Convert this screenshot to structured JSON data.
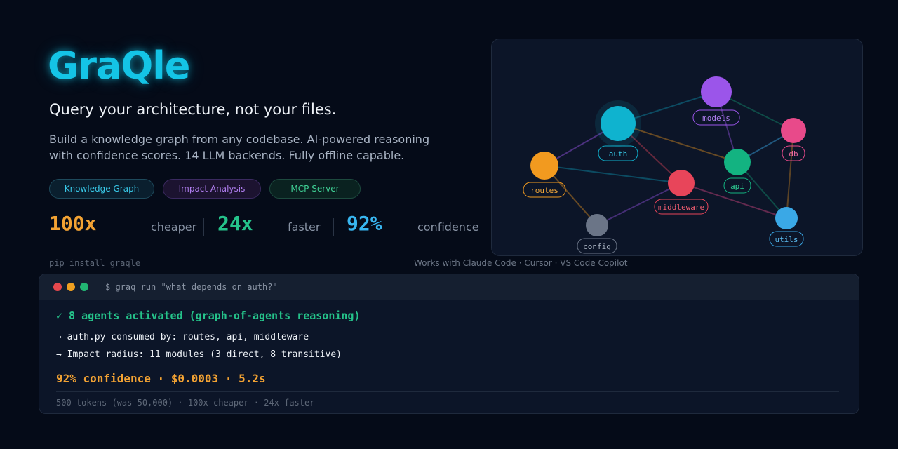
{
  "brand": {
    "name": "GraQle",
    "accent": "#14c4e6"
  },
  "hero": {
    "tagline": "Query your architecture, not your files.",
    "description": "Build a knowledge graph from any codebase. AI-powered reasoning with confidence scores. 14 LLM backends. Fully offline capable."
  },
  "pills": [
    {
      "label": "Knowledge Graph",
      "color": "#38c7e6"
    },
    {
      "label": "Impact Analysis",
      "color": "#b07ef0"
    },
    {
      "label": "MCP Server",
      "color": "#3fcf94"
    }
  ],
  "stats": [
    {
      "value": "100x",
      "label": "cheaper",
      "color": "#f2a233"
    },
    {
      "value": "24x",
      "label": "faster",
      "color": "#25c28a"
    },
    {
      "value": "92%",
      "label": "confidence",
      "color": "#38b6f0"
    }
  ],
  "install": "pip install graqle",
  "works_with": "Works with Claude Code · Cursor · VS Code Copilot",
  "graph": {
    "nodes": [
      {
        "id": "auth",
        "label": "auth",
        "color": "#0fb3cf"
      },
      {
        "id": "models",
        "label": "models",
        "color": "#9b55ea"
      },
      {
        "id": "db",
        "label": "db",
        "color": "#e84a8a"
      },
      {
        "id": "api",
        "label": "api",
        "color": "#13b381"
      },
      {
        "id": "routes",
        "label": "routes",
        "color": "#f29a1f"
      },
      {
        "id": "middleware",
        "label": "middleware",
        "color": "#e8455a"
      },
      {
        "id": "utils",
        "label": "utils",
        "color": "#3aa8e6"
      },
      {
        "id": "config",
        "label": "config",
        "color": "#6b7587"
      }
    ]
  },
  "terminal": {
    "dot_colors": [
      "#e5484d",
      "#f0a020",
      "#22b573"
    ],
    "command": "$ graq run \"what depends on auth?\"",
    "status": "✓ 8 agents activated (graph-of-agents reasoning)",
    "line1": "→ auth.py consumed by: routes, api, middleware",
    "line2": "→ Impact radius: 11 modules (3 direct, 8 transitive)",
    "summary": "92% confidence · $0.0003 · 5.2s",
    "footer": "500 tokens (was 50,000) · 100x cheaper · 24x faster"
  }
}
